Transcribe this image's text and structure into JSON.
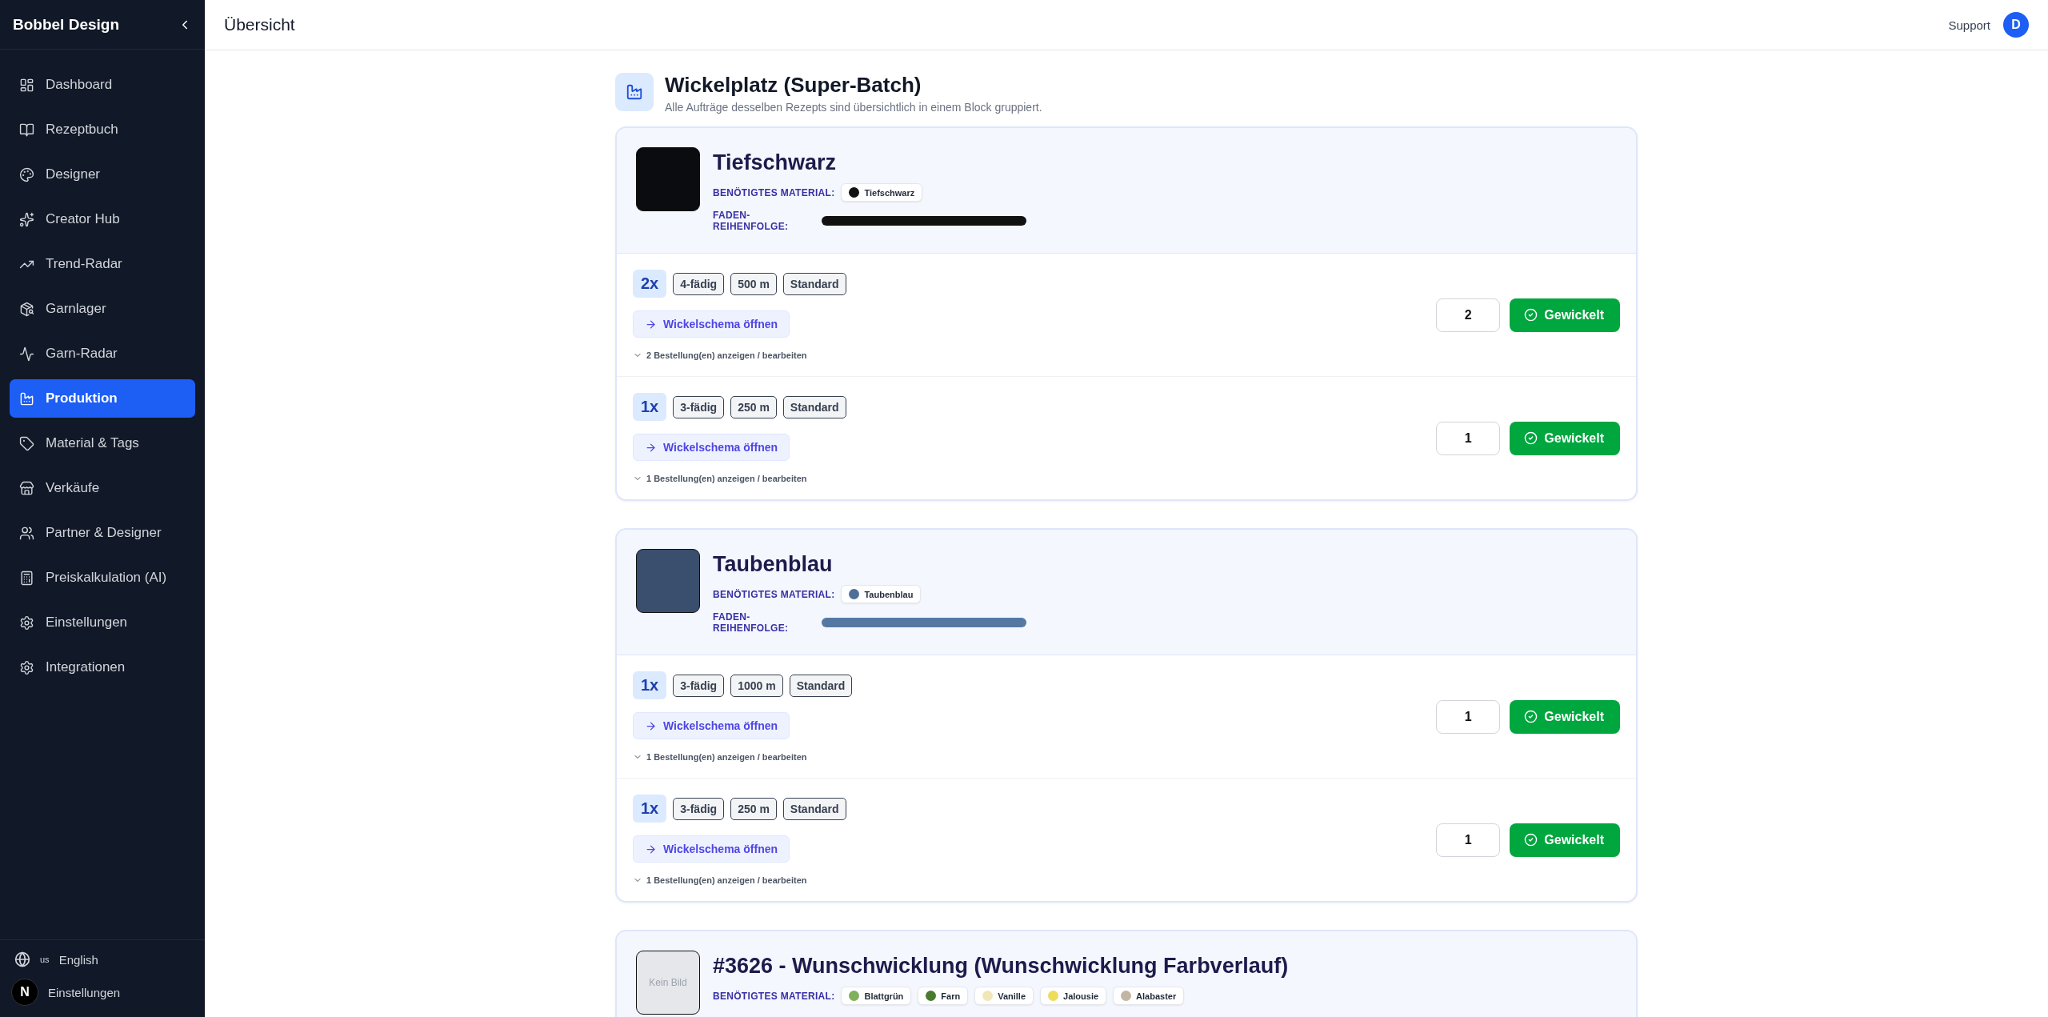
{
  "sidebar": {
    "brand": "Bobbel Design",
    "items": [
      {
        "label": "Dashboard",
        "selected": false
      },
      {
        "label": "Rezeptbuch",
        "selected": false
      },
      {
        "label": "Designer",
        "selected": false
      },
      {
        "label": "Creator Hub",
        "selected": false
      },
      {
        "label": "Trend-Radar",
        "selected": false
      },
      {
        "label": "Garnlager",
        "selected": false
      },
      {
        "label": "Garn-Radar",
        "selected": false
      },
      {
        "label": "Produktion",
        "selected": true
      },
      {
        "label": "Material & Tags",
        "selected": false
      },
      {
        "label": "Verkäufe",
        "selected": false
      },
      {
        "label": "Partner & Designer",
        "selected": false
      },
      {
        "label": "Preiskalkulation (AI)",
        "selected": false
      },
      {
        "label": "Einstellungen",
        "selected": false
      },
      {
        "label": "Integrationen",
        "selected": false
      }
    ],
    "language": {
      "flag": "us",
      "label": "English"
    },
    "settings": {
      "avatar": "N",
      "label": "Einstellungen"
    }
  },
  "header": {
    "title": "Übersicht",
    "support": "Support",
    "avatar": "D"
  },
  "section": {
    "title": "Wickelplatz (Super-Batch)",
    "subtitle": "Alle Aufträge desselben Rezepts sind übersichtlich in einem Block gruppiert."
  },
  "batches": [
    {
      "kind": "swatch",
      "name": "Tiefschwarz",
      "color": "#0b0c0f",
      "material_label": "BENÖTIGTES MATERIAL:",
      "materials": [
        {
          "name": "Tiefschwarz",
          "color": "#111111"
        }
      ],
      "sequence_label": "FADEN-REIHENFOLGE:",
      "sequence": [
        {
          "color": "#111111"
        }
      ],
      "orders": [
        {
          "count": "2x",
          "tags": [
            "4-fädig",
            "500 m",
            "Standard"
          ],
          "schema_button": "Wickelschema öffnen",
          "details": "2 Bestellung(en) anzeigen / bearbeiten",
          "quantity": "2",
          "done_button": "Gewickelt"
        },
        {
          "count": "1x",
          "tags": [
            "3-fädig",
            "250 m",
            "Standard"
          ],
          "schema_button": "Wickelschema öffnen",
          "details": "1 Bestellung(en) anzeigen / bearbeiten",
          "quantity": "1",
          "done_button": "Gewickelt"
        }
      ]
    },
    {
      "kind": "swatch",
      "name": "Taubenblau",
      "color": "#3a4f6e",
      "material_label": "BENÖTIGTES MATERIAL:",
      "materials": [
        {
          "name": "Taubenblau",
          "color": "#4f6f9a"
        }
      ],
      "sequence_label": "FADEN-REIHENFOLGE:",
      "sequence": [
        {
          "color": "#5578a3"
        }
      ],
      "orders": [
        {
          "count": "1x",
          "tags": [
            "3-fädig",
            "1000 m",
            "Standard"
          ],
          "schema_button": "Wickelschema öffnen",
          "details": "1 Bestellung(en) anzeigen / bearbeiten",
          "quantity": "1",
          "done_button": "Gewickelt"
        },
        {
          "count": "1x",
          "tags": [
            "3-fädig",
            "250 m",
            "Standard"
          ],
          "schema_button": "Wickelschema öffnen",
          "details": "1 Bestellung(en) anzeigen / bearbeiten",
          "quantity": "1",
          "done_button": "Gewickelt"
        }
      ]
    },
    {
      "kind": "none",
      "name": "#3626 - Wunschwicklung (Wunschwicklung Farbverlauf)",
      "image_text": "Kein Bild",
      "material_label": "BENÖTIGTES MATERIAL:",
      "materials": [
        {
          "name": "Blattgrün",
          "color": "#7fb05a"
        },
        {
          "name": "Farn",
          "color": "#4a7a2e"
        },
        {
          "name": "Vanille",
          "color": "#f1e6b8"
        },
        {
          "name": "Jalousie",
          "color": "#eedc5c"
        },
        {
          "name": "Alabaster",
          "color": "#c1b5a4"
        }
      ]
    }
  ]
}
